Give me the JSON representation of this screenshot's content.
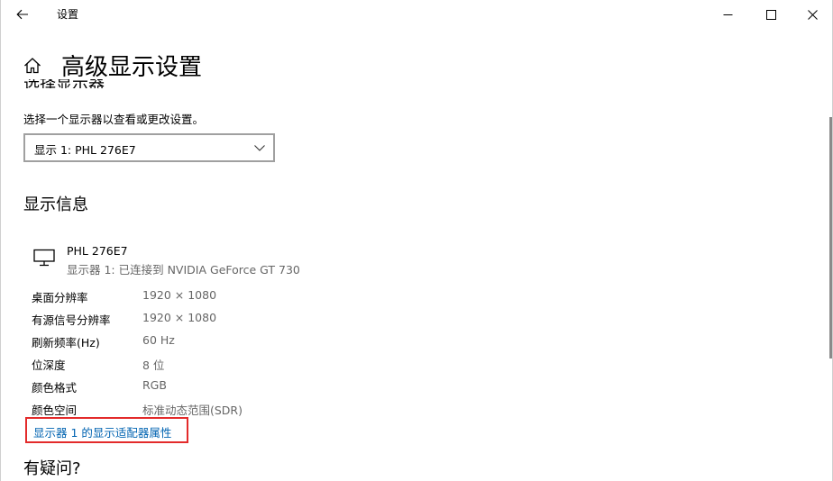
{
  "window": {
    "title": "设置"
  },
  "icons": {
    "back": "arrow-left",
    "home": "home",
    "minimize": "minimize",
    "maximize": "maximize",
    "close": "close",
    "dropdown": "chevron-down",
    "monitor": "monitor"
  },
  "page": {
    "title": "高级显示设置",
    "clipped_heading": "选择显示器",
    "select_description": "选择一个显示器以查看或更改设置。",
    "display_select": {
      "value": "显示 1: PHL 276E7"
    }
  },
  "display_info": {
    "section_title": "显示信息",
    "monitor_name": "PHL 276E7",
    "monitor_connection": "显示器 1: 已连接到 NVIDIA GeForce GT 730",
    "rows": [
      {
        "label": "桌面分辨率",
        "value": "1920 × 1080"
      },
      {
        "label": "有源信号分辨率",
        "value": "1920 × 1080"
      },
      {
        "label": "刷新频率(Hz)",
        "value": "60 Hz"
      },
      {
        "label": "位深度",
        "value": "8 位"
      },
      {
        "label": "颜色格式",
        "value": "RGB"
      },
      {
        "label": "颜色空间",
        "value": "标准动态范围(SDR)"
      }
    ],
    "adapter_link": "显示器 1 的显示适配器属性"
  },
  "help": {
    "title": "有疑问?"
  },
  "colors": {
    "link": "#0063b1",
    "highlight_border": "#e32b2b",
    "secondary_text": "#666666"
  }
}
